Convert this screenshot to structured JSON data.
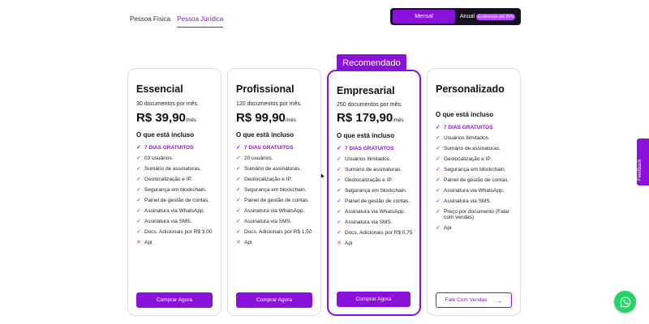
{
  "tabs": [
    {
      "label": "Pessoa Física",
      "active": false
    },
    {
      "label": "Pessoa Jurídica",
      "active": true
    }
  ],
  "billing_toggle": {
    "monthly": "Mensal",
    "annual": "Anual",
    "discount_badge": "Economize até 25%",
    "selected": "Mensal"
  },
  "recommended_label": "Recomendado",
  "included_heading": "O que está incluso",
  "plans": [
    {
      "name": "Essencial",
      "docs": "30 documentos por mês.",
      "price": "R$ 39,90",
      "per": "/mês",
      "features": [
        {
          "text": "7 DIAS GRATUITOS",
          "ok": true
        },
        {
          "text": "03 usuários.",
          "ok": true
        },
        {
          "text": "Sumário de assinaturas.",
          "ok": true
        },
        {
          "text": "Geolocalização e IP.",
          "ok": true
        },
        {
          "text": "Segurança em blockchain.",
          "ok": true
        },
        {
          "text": "Painel de gestão de contas.",
          "ok": true
        },
        {
          "text": "Assinatura via WhatsApp.",
          "ok": true
        },
        {
          "text": "Assinatura via SMS.",
          "ok": true
        },
        {
          "text": "Docs. Adicionais por R$ 3,00",
          "ok": true
        },
        {
          "text": "Api",
          "ok": false
        }
      ],
      "cta": "Comprar Agora"
    },
    {
      "name": "Profissional",
      "docs": "120 documentos por mês.",
      "price": "R$ 99,90",
      "per": "/mês",
      "features": [
        {
          "text": "7 DIAS GRATUITOS",
          "ok": true
        },
        {
          "text": "20 usuários.",
          "ok": true
        },
        {
          "text": "Sumário de assinaturas.",
          "ok": true
        },
        {
          "text": "Geolocalização e IP.",
          "ok": true
        },
        {
          "text": "Segurança em blockchain.",
          "ok": true
        },
        {
          "text": "Painel de gestão de contas.",
          "ok": true
        },
        {
          "text": "Assinatura via WhatsApp.",
          "ok": true
        },
        {
          "text": "Assinatura via SMS.",
          "ok": true
        },
        {
          "text": "Docs. Adicionais por R$ 1,50",
          "ok": true
        },
        {
          "text": "Api",
          "ok": false
        }
      ],
      "cta": "Comprar Agora"
    },
    {
      "name": "Empresarial",
      "docs": "250 documentos por mês.",
      "price": "R$ 179,90",
      "per": "/mês",
      "features": [
        {
          "text": "7 DIAS GRATUITOS",
          "ok": true
        },
        {
          "text": "Usuários Ilimitados.",
          "ok": true
        },
        {
          "text": "Sumário de assinaturas.",
          "ok": true
        },
        {
          "text": "Geolocalização e IP.",
          "ok": true
        },
        {
          "text": "Segurança em blockchain.",
          "ok": true
        },
        {
          "text": "Painel de gestão de contas.",
          "ok": true
        },
        {
          "text": "Assinatura via WhatsApp.",
          "ok": true
        },
        {
          "text": "Assinatura via SMS.",
          "ok": true
        },
        {
          "text": "Docs. Adicionais por R$ 0,75",
          "ok": true
        },
        {
          "text": "Api",
          "ok": false
        }
      ],
      "cta": "Comprar Agora"
    },
    {
      "name": "Personalizado",
      "features": [
        {
          "text": "7 DIAS GRATUITOS",
          "ok": true
        },
        {
          "text": "Usuários Ilimitados.",
          "ok": true
        },
        {
          "text": "Sumário de assinaturas.",
          "ok": true
        },
        {
          "text": "Geolocalização e IP.",
          "ok": true
        },
        {
          "text": "Segurança em blockchain.",
          "ok": true
        },
        {
          "text": "Painel de gestão de contas.",
          "ok": true
        },
        {
          "text": "Assinatura via WhatsApp.",
          "ok": true
        },
        {
          "text": "Assinatura via SMS.",
          "ok": true
        },
        {
          "text": "Preço por documento (Falar com vendas)",
          "ok": true
        },
        {
          "text": "Api",
          "ok": true
        }
      ],
      "cta": "Fale Com Vendas"
    }
  ],
  "feedback_label": "Feedback",
  "icons": {
    "check": "check-icon",
    "cross": "cross-icon",
    "arrow": "arrow-right-icon",
    "whatsapp": "whatsapp-icon",
    "cursor": "mouse-cursor-icon"
  },
  "colors": {
    "accent": "#8a12d8",
    "toggle_bg": "#17101e",
    "cross": "#e23a3a",
    "whatsapp": "#25d366"
  }
}
